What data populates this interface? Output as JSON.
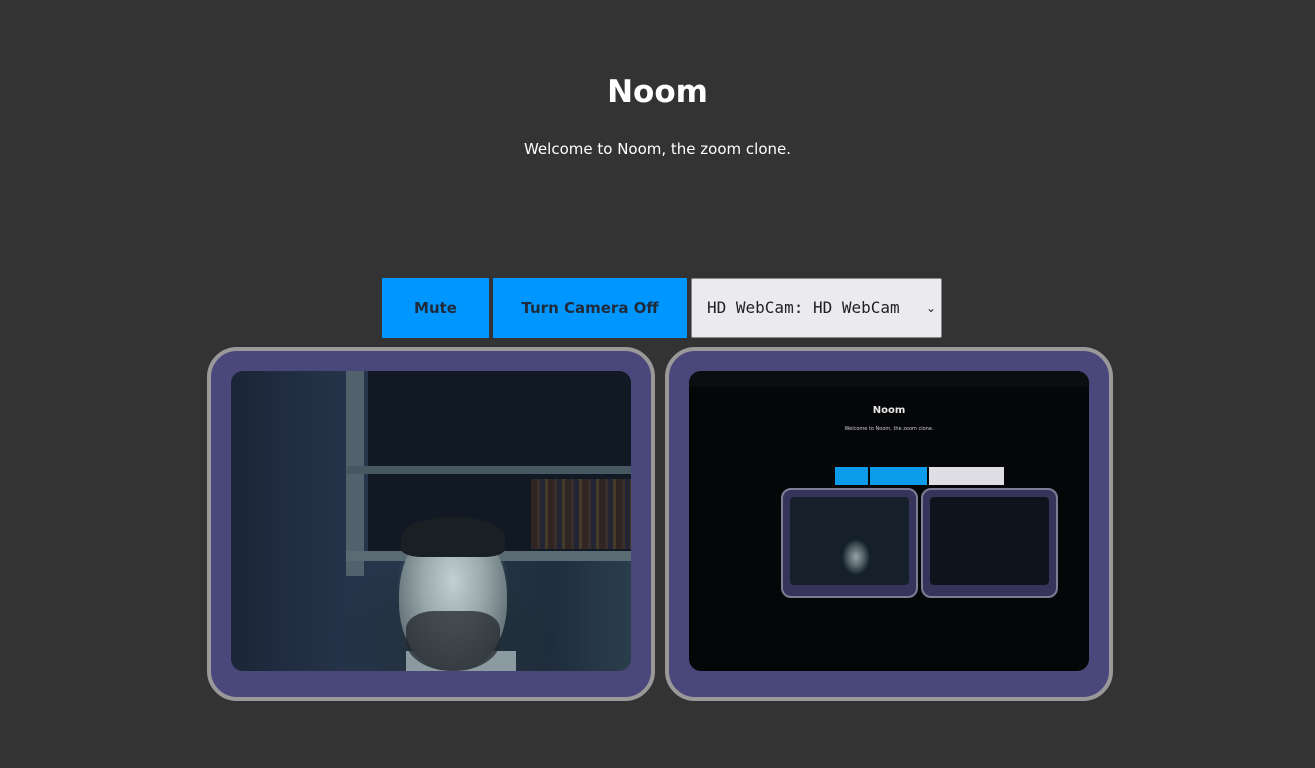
{
  "header": {
    "title": "Noom",
    "subtitle": "Welcome to Noom, the zoom clone."
  },
  "controls": {
    "mute_label": "Mute",
    "camera_label": "Turn Camera Off",
    "camera_select": {
      "selected": "HD WebCam: HD WebCam",
      "options": [
        "HD WebCam: HD WebCam"
      ]
    }
  },
  "videos": [
    {
      "name": "my-face",
      "description": "Local webcam stream"
    },
    {
      "name": "peer-face",
      "description": "Remote peer stream"
    }
  ],
  "colors": {
    "background": "#333333",
    "button": "#0096ff",
    "frame": "#4a477b",
    "frame_border": "#9a9898"
  },
  "icons": {
    "select_chevron": "chevron-down-icon"
  }
}
